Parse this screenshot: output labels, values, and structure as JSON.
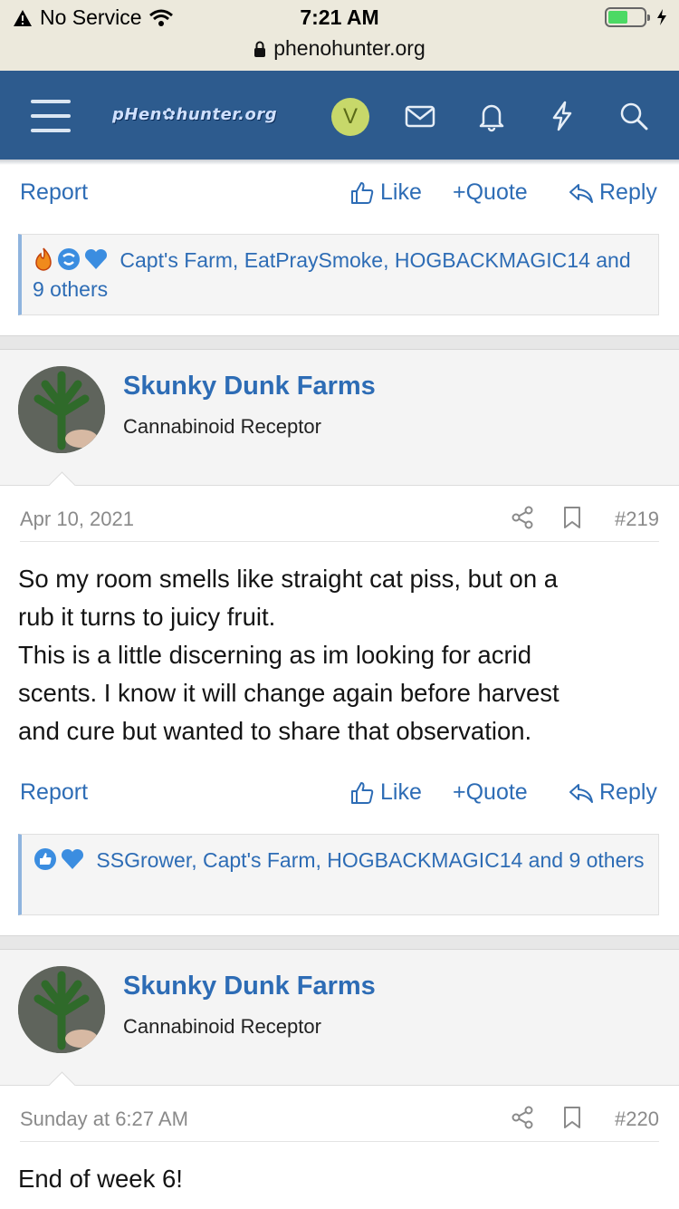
{
  "status_bar": {
    "carrier": "No Service",
    "time": "7:21 AM",
    "url": "phenohunter.org"
  },
  "header": {
    "logo": "pHen✿hunter.org",
    "avatar_letter": "V"
  },
  "actions": {
    "report": "Report",
    "like": "Like",
    "quote": "+Quote",
    "reply": "Reply"
  },
  "posts": [
    {
      "reactions_text": "Capt's Farm, EatPraySmoke, HOGBACKMAGIC14 and 9 others"
    },
    {
      "author": "Skunky Dunk Farms",
      "user_title": "Cannabinoid Receptor",
      "date": "Apr 10, 2021",
      "number": "#219",
      "body": [
        "So my room smells like straight cat piss, but on a",
        "rub it turns to juicy fruit.",
        "This is a little discerning as im looking for acrid",
        "scents. I know it will change again before harvest",
        "and cure but wanted to share that observation."
      ],
      "reactions_text": "SSGrower, Capt's Farm, HOGBACKMAGIC14 and 9 others"
    },
    {
      "author": "Skunky Dunk Farms",
      "user_title": "Cannabinoid Receptor",
      "date": "Sunday at 6:27 AM",
      "number": "#220",
      "body": [
        "End of week 6!"
      ]
    }
  ],
  "colors": {
    "header_bg": "#2d5b8e",
    "link": "#2d6cb5",
    "avatar_bg": "#c7d86a"
  },
  "icons": [
    "warning-icon",
    "wifi-icon",
    "battery-icon",
    "lock-icon",
    "menu-icon",
    "mail-icon",
    "bell-icon",
    "bolt-icon",
    "search-icon",
    "like-icon",
    "reply-icon",
    "share-icon",
    "bookmark-icon",
    "fire-reaction-icon",
    "thumbs-up-reaction-icon",
    "heart-reaction-icon"
  ]
}
